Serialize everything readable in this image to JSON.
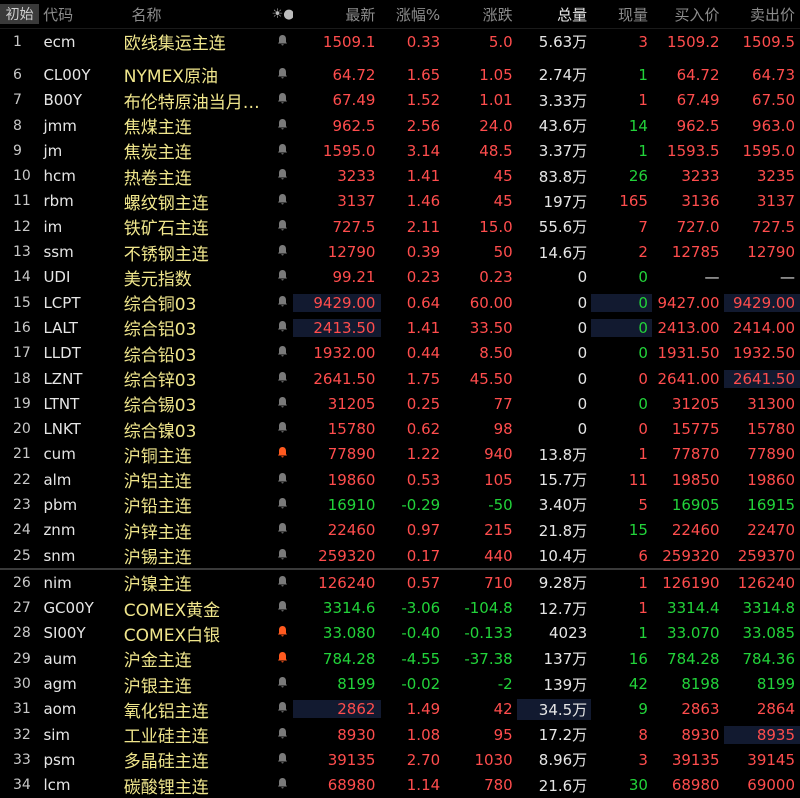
{
  "header": {
    "idx": "初始",
    "code": "代码",
    "name": "名称",
    "settings": "☀●",
    "last": "最新",
    "pct": "涨幅%",
    "chg": "涨跌",
    "vol": "总量",
    "cur": "现量",
    "bid": "买入价",
    "ask": "卖出价"
  },
  "colors": {
    "up": "#ff4d4d",
    "down": "#22d33a",
    "name": "#f0e68c",
    "alert_bell": "#ff5a1f",
    "highlight": "#121a30"
  },
  "icons": {
    "bell": "bell-icon"
  },
  "rows": [
    {
      "idx": "1",
      "code": "ecm",
      "name": "欧线集运主连",
      "last": "1509.1",
      "pct": "0.33",
      "chg": "5.0",
      "vol": "5.63万",
      "cur": "3",
      "bid": "1509.2",
      "ask": "1509.5",
      "dir": "up",
      "cur_dir": "up"
    },
    {
      "idx": "6",
      "code": "CL00Y",
      "name": "NYMEX原油",
      "last": "64.72",
      "pct": "1.65",
      "chg": "1.05",
      "vol": "2.74万",
      "cur": "1",
      "bid": "64.72",
      "ask": "64.73",
      "dir": "up",
      "cur_dir": "down"
    },
    {
      "idx": "7",
      "code": "B00Y",
      "name": "布伦特原油当月…",
      "last": "67.49",
      "pct": "1.52",
      "chg": "1.01",
      "vol": "3.33万",
      "cur": "1",
      "bid": "67.49",
      "ask": "67.50",
      "dir": "up",
      "cur_dir": "up"
    },
    {
      "idx": "8",
      "code": "jmm",
      "name": "焦煤主连",
      "last": "962.5",
      "pct": "2.56",
      "chg": "24.0",
      "vol": "43.6万",
      "cur": "14",
      "bid": "962.5",
      "ask": "963.0",
      "dir": "up",
      "cur_dir": "down"
    },
    {
      "idx": "9",
      "code": "jm",
      "name": "焦炭主连",
      "last": "1595.0",
      "pct": "3.14",
      "chg": "48.5",
      "vol": "3.37万",
      "cur": "1",
      "bid": "1593.5",
      "ask": "1595.0",
      "dir": "up",
      "cur_dir": "down"
    },
    {
      "idx": "10",
      "code": "hcm",
      "name": "热卷主连",
      "last": "3233",
      "pct": "1.41",
      "chg": "45",
      "vol": "83.8万",
      "cur": "26",
      "bid": "3233",
      "ask": "3235",
      "dir": "up",
      "cur_dir": "down"
    },
    {
      "idx": "11",
      "code": "rbm",
      "name": "螺纹钢主连",
      "last": "3137",
      "pct": "1.46",
      "chg": "45",
      "vol": "197万",
      "cur": "165",
      "bid": "3136",
      "ask": "3137",
      "dir": "up",
      "cur_dir": "up"
    },
    {
      "idx": "12",
      "code": "im",
      "name": "铁矿石主连",
      "last": "727.5",
      "pct": "2.11",
      "chg": "15.0",
      "vol": "55.6万",
      "cur": "7",
      "bid": "727.0",
      "ask": "727.5",
      "dir": "up",
      "cur_dir": "up"
    },
    {
      "idx": "13",
      "code": "ssm",
      "name": "不锈钢主连",
      "last": "12790",
      "pct": "0.39",
      "chg": "50",
      "vol": "14.6万",
      "cur": "2",
      "bid": "12785",
      "ask": "12790",
      "dir": "up",
      "cur_dir": "up"
    },
    {
      "idx": "14",
      "code": "UDI",
      "name": "美元指数",
      "last": "99.21",
      "pct": "0.23",
      "chg": "0.23",
      "vol": "0",
      "cur": "0",
      "bid": "—",
      "ask": "—",
      "dir": "up",
      "cur_dir": "down"
    },
    {
      "idx": "15",
      "code": "LCPT",
      "name": "综合铜03",
      "last": "9429.00",
      "pct": "0.64",
      "chg": "60.00",
      "vol": "0",
      "cur": "0",
      "bid": "9427.00",
      "ask": "9429.00",
      "dir": "up",
      "cur_dir": "down"
    },
    {
      "idx": "16",
      "code": "LALT",
      "name": "综合铝03",
      "last": "2413.50",
      "pct": "1.41",
      "chg": "33.50",
      "vol": "0",
      "cur": "0",
      "bid": "2413.00",
      "ask": "2414.00",
      "dir": "up",
      "cur_dir": "down"
    },
    {
      "idx": "17",
      "code": "LLDT",
      "name": "综合铅03",
      "last": "1932.00",
      "pct": "0.44",
      "chg": "8.50",
      "vol": "0",
      "cur": "0",
      "bid": "1931.50",
      "ask": "1932.50",
      "dir": "up",
      "cur_dir": "down"
    },
    {
      "idx": "18",
      "code": "LZNT",
      "name": "综合锌03",
      "last": "2641.50",
      "pct": "1.75",
      "chg": "45.50",
      "vol": "0",
      "cur": "0",
      "bid": "2641.00",
      "ask": "2641.50",
      "dir": "up",
      "cur_dir": "up"
    },
    {
      "idx": "19",
      "code": "LTNT",
      "name": "综合锡03",
      "last": "31205",
      "pct": "0.25",
      "chg": "77",
      "vol": "0",
      "cur": "0",
      "bid": "31205",
      "ask": "31300",
      "dir": "up",
      "cur_dir": "down"
    },
    {
      "idx": "20",
      "code": "LNKT",
      "name": "综合镍03",
      "last": "15780",
      "pct": "0.62",
      "chg": "98",
      "vol": "0",
      "cur": "0",
      "bid": "15775",
      "ask": "15780",
      "dir": "up",
      "cur_dir": "up"
    },
    {
      "idx": "21",
      "code": "cum",
      "name": "沪铜主连",
      "last": "77890",
      "pct": "1.22",
      "chg": "940",
      "vol": "13.8万",
      "cur": "1",
      "bid": "77870",
      "ask": "77890",
      "dir": "up",
      "cur_dir": "up",
      "bell_active": true
    },
    {
      "idx": "22",
      "code": "alm",
      "name": "沪铝主连",
      "last": "19860",
      "pct": "0.53",
      "chg": "105",
      "vol": "15.7万",
      "cur": "11",
      "bid": "19850",
      "ask": "19860",
      "dir": "up",
      "cur_dir": "up"
    },
    {
      "idx": "23",
      "code": "pbm",
      "name": "沪铅主连",
      "last": "16910",
      "pct": "-0.29",
      "chg": "-50",
      "vol": "3.40万",
      "cur": "5",
      "bid": "16905",
      "ask": "16915",
      "dir": "down",
      "cur_dir": "up"
    },
    {
      "idx": "24",
      "code": "znm",
      "name": "沪锌主连",
      "last": "22460",
      "pct": "0.97",
      "chg": "215",
      "vol": "21.8万",
      "cur": "15",
      "bid": "22460",
      "ask": "22470",
      "dir": "up",
      "cur_dir": "down"
    },
    {
      "idx": "25",
      "code": "snm",
      "name": "沪锡主连",
      "last": "259320",
      "pct": "0.17",
      "chg": "440",
      "vol": "10.4万",
      "cur": "6",
      "bid": "259320",
      "ask": "259370",
      "dir": "up",
      "cur_dir": "up"
    },
    {
      "idx": "26",
      "code": "nim",
      "name": "沪镍主连",
      "last": "126240",
      "pct": "0.57",
      "chg": "710",
      "vol": "9.28万",
      "cur": "1",
      "bid": "126190",
      "ask": "126240",
      "dir": "up",
      "cur_dir": "up"
    },
    {
      "idx": "27",
      "code": "GC00Y",
      "name": "COMEX黄金",
      "last": "3314.6",
      "pct": "-3.06",
      "chg": "-104.8",
      "vol": "12.7万",
      "cur": "1",
      "bid": "3314.4",
      "ask": "3314.8",
      "dir": "down",
      "cur_dir": "up"
    },
    {
      "idx": "28",
      "code": "SI00Y",
      "name": "COMEX白银",
      "last": "33.080",
      "pct": "-0.40",
      "chg": "-0.133",
      "vol": "4023",
      "cur": "1",
      "bid": "33.070",
      "ask": "33.085",
      "dir": "down",
      "cur_dir": "down",
      "bell_active": true
    },
    {
      "idx": "29",
      "code": "aum",
      "name": "沪金主连",
      "last": "784.28",
      "pct": "-4.55",
      "chg": "-37.38",
      "vol": "137万",
      "cur": "16",
      "bid": "784.28",
      "ask": "784.36",
      "dir": "down",
      "cur_dir": "down",
      "bell_active": true
    },
    {
      "idx": "30",
      "code": "agm",
      "name": "沪银主连",
      "last": "8199",
      "pct": "-0.02",
      "chg": "-2",
      "vol": "139万",
      "cur": "42",
      "bid": "8198",
      "ask": "8199",
      "dir": "down",
      "cur_dir": "down"
    },
    {
      "idx": "31",
      "code": "aom",
      "name": "氧化铝主连",
      "last": "2862",
      "pct": "1.49",
      "chg": "42",
      "vol": "34.5万",
      "cur": "9",
      "bid": "2863",
      "ask": "2864",
      "dir": "up",
      "cur_dir": "down"
    },
    {
      "idx": "32",
      "code": "sim",
      "name": "工业硅主连",
      "last": "8930",
      "pct": "1.08",
      "chg": "95",
      "vol": "17.2万",
      "cur": "8",
      "bid": "8930",
      "ask": "8935",
      "dir": "up",
      "cur_dir": "up"
    },
    {
      "idx": "33",
      "code": "psm",
      "name": "多晶硅主连",
      "last": "39135",
      "pct": "2.70",
      "chg": "1030",
      "vol": "8.96万",
      "cur": "3",
      "bid": "39135",
      "ask": "39145",
      "dir": "up",
      "cur_dir": "up"
    },
    {
      "idx": "34",
      "code": "lcm",
      "name": "碳酸锂主连",
      "last": "68980",
      "pct": "1.14",
      "chg": "780",
      "vol": "21.6万",
      "cur": "30",
      "bid": "68980",
      "ask": "69000",
      "dir": "up",
      "cur_dir": "down"
    }
  ]
}
